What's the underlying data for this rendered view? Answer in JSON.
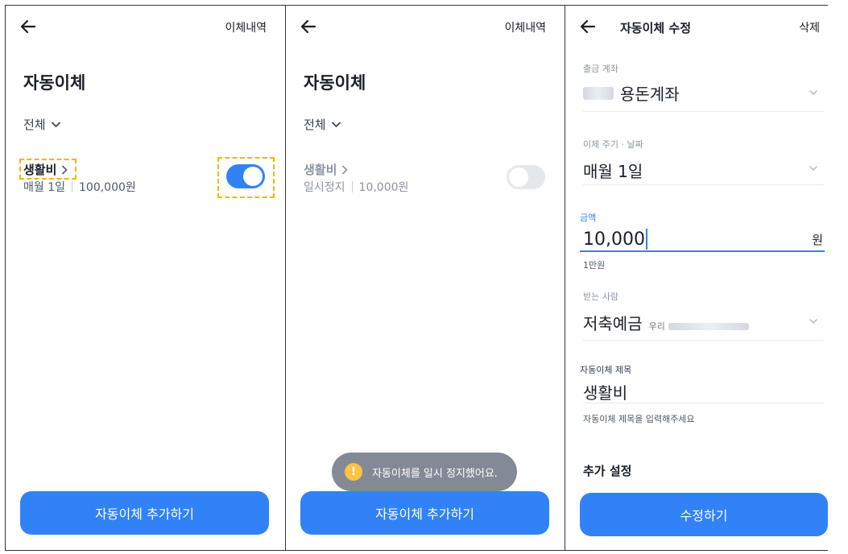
{
  "screen1": {
    "header_link": "이체내역",
    "title": "자동이체",
    "filter": "전체",
    "item": {
      "name": "생활비",
      "schedule": "매월 1일",
      "amount": "100,000원",
      "enabled": true
    },
    "cta": "자동이체 추가하기"
  },
  "screen2": {
    "header_link": "이체내역",
    "title": "자동이체",
    "filter": "전체",
    "item": {
      "name": "생활비",
      "status": "일시정지",
      "amount": "10,000원",
      "enabled": false
    },
    "toast": "자동이체를 일시 정지했어요.",
    "cta": "자동이체 추가하기"
  },
  "screen3": {
    "title": "자동이체 수정",
    "delete": "삭제",
    "account_label": "출금 계좌",
    "account_value": "용돈계좌",
    "cycle_label": "이체 주기 · 날짜",
    "cycle_value": "매월 1일",
    "amount_label": "금액",
    "amount_value": "10,000",
    "amount_unit": "원",
    "amount_helper": "1만원",
    "recipient_label": "받는 사람",
    "recipient_name": "저축예금",
    "recipient_bank": "우리",
    "title_label": "자동이체 제목",
    "title_value": "생활비",
    "title_helper": "자동이체 제목을 입력해주세요",
    "extra_section": "추가 설정",
    "cta": "수정하기"
  },
  "colors": {
    "accent": "#3182f6",
    "highlight": "#f5b400",
    "warning": "#ffc342"
  },
  "icons": [
    "back-arrow-icon",
    "chevron-down-icon",
    "chevron-right-icon",
    "warning-icon"
  ]
}
